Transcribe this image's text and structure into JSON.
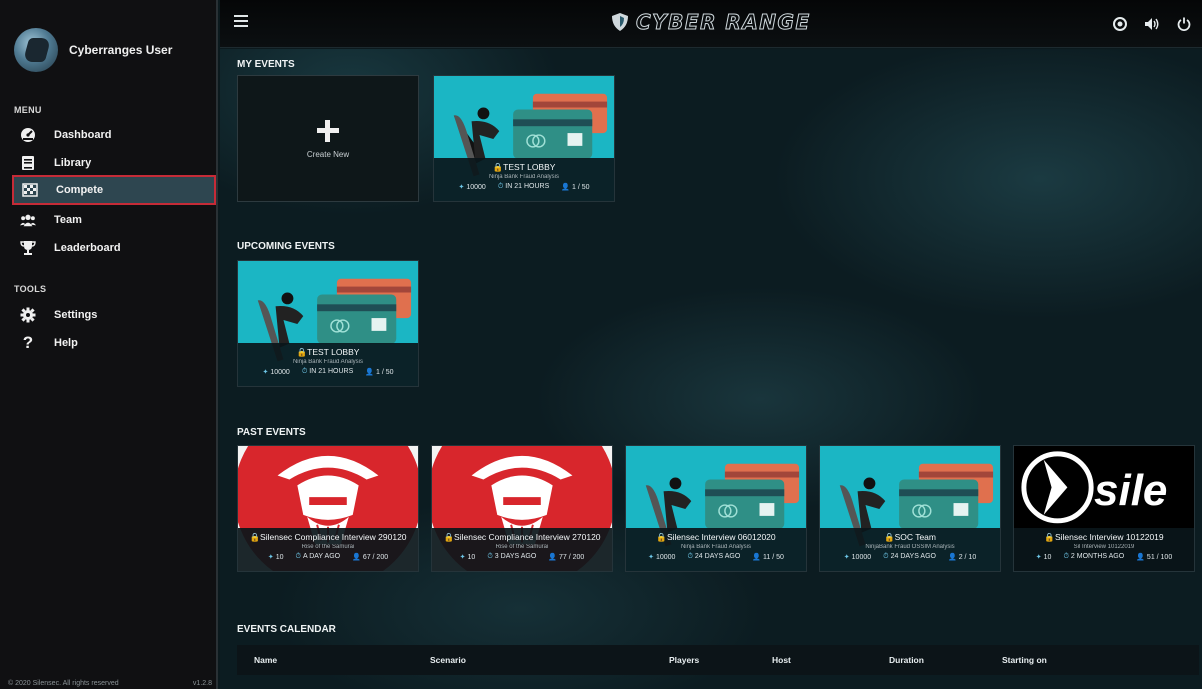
{
  "user": {
    "name": "Cyberranges User"
  },
  "sidebar": {
    "menu_label": "MENU",
    "tools_label": "TOOLS",
    "items": [
      {
        "label": "Dashboard",
        "icon": "dashboard-icon"
      },
      {
        "label": "Library",
        "icon": "library-icon"
      },
      {
        "label": "Compete",
        "icon": "checkered-flag-icon",
        "active": true
      },
      {
        "label": "Team",
        "icon": "team-icon"
      },
      {
        "label": "Leaderboard",
        "icon": "trophy-icon"
      }
    ],
    "tools": [
      {
        "label": "Settings",
        "icon": "gear-icon"
      },
      {
        "label": "Help",
        "icon": "question-icon"
      }
    ],
    "footer_copyright": "© 2020 Silensec. All rights reserved",
    "footer_version": "v1.2.8"
  },
  "header": {
    "logo_text": "CYBER RANGE"
  },
  "sections": {
    "my_events": "MY EVENTS",
    "upcoming_events": "UPCOMING EVENTS",
    "past_events": "PAST EVENTS",
    "events_calendar": "EVENTS CALENDAR"
  },
  "create_new": "Create New",
  "my_events": [
    {
      "title": "TEST LOBBY",
      "scenario": "Ninja Bank Fraud Analysis",
      "points": "10000",
      "time": "IN 21 HOURS",
      "players": "1 / 50",
      "image": "ninja-card"
    }
  ],
  "upcoming_events": [
    {
      "title": "TEST LOBBY",
      "scenario": "Ninja Bank Fraud Analysis",
      "points": "10000",
      "time": "IN 21 HOURS",
      "players": "1 / 50",
      "image": "ninja-card"
    }
  ],
  "past_events": [
    {
      "title": "Silensec Compliance Interview 290120",
      "scenario": "Rise of the Samurai",
      "points": "10",
      "time": "A DAY AGO",
      "players": "67 / 200",
      "image": "samurai"
    },
    {
      "title": "Silensec Compliance Interview 270120",
      "scenario": "Rise of the Samurai",
      "points": "10",
      "time": "3 DAYS AGO",
      "players": "77 / 200",
      "image": "samurai"
    },
    {
      "title": "Silensec Interview 06012020",
      "scenario": "Ninja Bank Fraud Analysis",
      "points": "10000",
      "time": "24 DAYS AGO",
      "players": "11 / 50",
      "image": "ninja-card"
    },
    {
      "title": "SOC Team",
      "scenario": "NinjaBank Fraud OSSIM Analysis",
      "points": "10000",
      "time": "24 DAYS AGO",
      "players": "2 / 10",
      "image": "ninja-card"
    },
    {
      "title": "Silensec Interview 10122019",
      "scenario": "Sil Interview 10122019",
      "points": "10",
      "time": "2 MONTHS AGO",
      "players": "51 / 100",
      "image": "silensec-logo",
      "logo_text": "sile"
    }
  ],
  "calendar": {
    "columns": [
      "Name",
      "Scenario",
      "Players",
      "Host",
      "Duration",
      "Starting on"
    ]
  }
}
